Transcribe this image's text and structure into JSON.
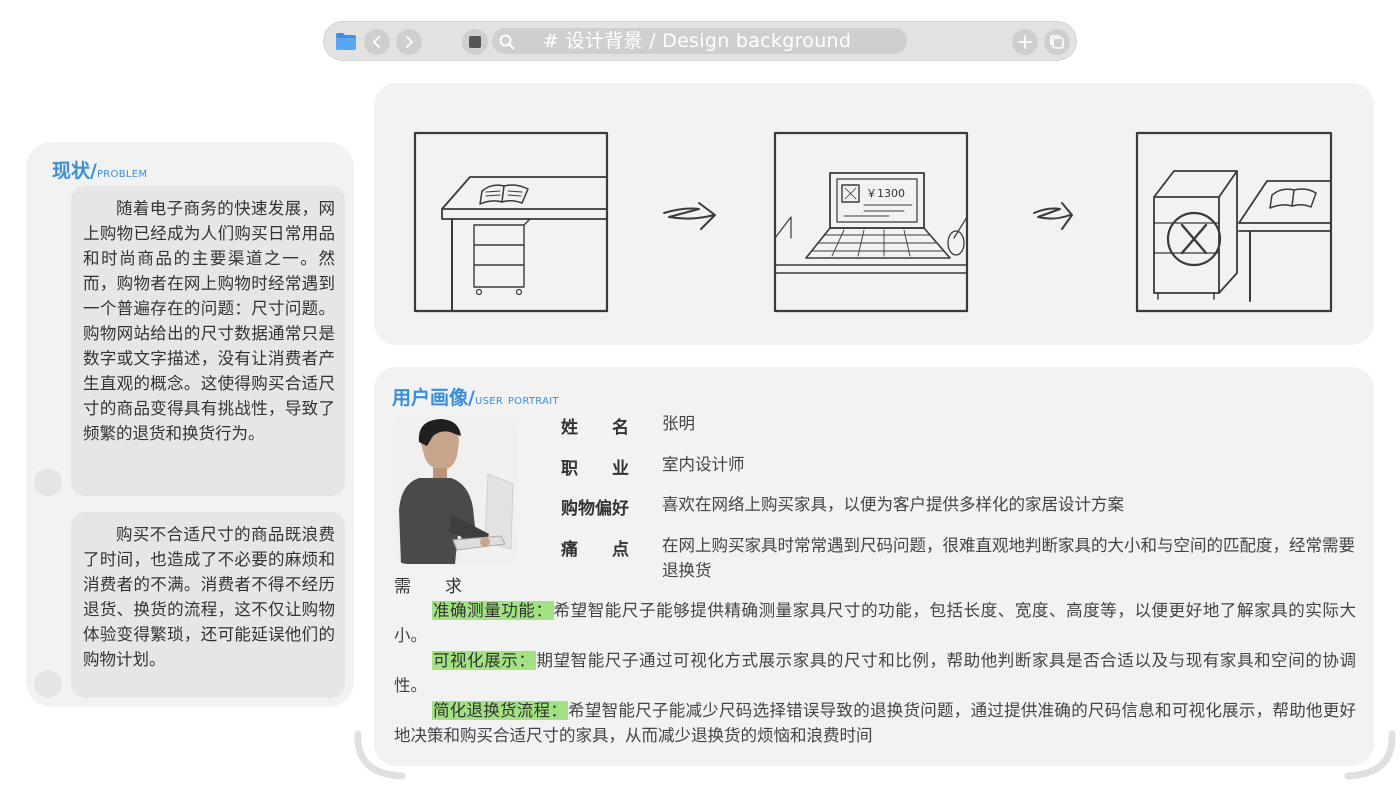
{
  "toolbar": {
    "address": "# 设计背景 / Design background"
  },
  "problem": {
    "title_zh": "现状/",
    "title_en": "problem",
    "paragraphs": [
      "随着电子商务的快速发展，网上购物已经成为人们购买日常用品和时尚商品的主要渠道之一。然而，购物者在网上购物时经常遇到一个普遍存在的问题：尺寸问题。购物网站给出的尺寸数据通常只是数字或文字描述，没有让消费者产生直观的概念。这使得购买合适尺寸的商品变得具有挑战性，导致了频繁的退货和换货行为。",
      "购买不合适尺寸的商品既浪费了时间，也造成了不必要的麻烦和消费者的不满。消费者不得不经历退货、换货的流程，这不仅让购物体验变得繁琐，还可能延误他们的购物计划。"
    ]
  },
  "storyboard": {
    "price_label": "￥1300"
  },
  "portrait": {
    "title_zh": "用户画像/",
    "title_en": "user portrait",
    "fields": [
      {
        "label": "姓　　名",
        "value": "张明"
      },
      {
        "label": "职　　业",
        "value": "室内设计师"
      },
      {
        "label": "购物偏好",
        "value": "喜欢在网络上购买家具，以便为客户提供多样化的家居设计方案"
      },
      {
        "label": "痛　　点",
        "value": "在网上购买家具时常常遇到尺码问题，很难直观地判断家具的大小和与空间的匹配度，经常需要退换货"
      }
    ],
    "needs_label": "需　　求",
    "needs": [
      {
        "title": "准确测量功能：",
        "text": "希望智能尺子能够提供精确测量家具尺寸的功能，包括长度、宽度、高度等，以便更好地了解家具的实际大小。"
      },
      {
        "title": "可视化展示：",
        "text": "期望智能尺子通过可视化方式展示家具的尺寸和比例，帮助他判断家具是否合适以及与现有家具和空间的协调性。"
      },
      {
        "title": "简化退换货流程：",
        "text": "希望智能尺子能减少尺码选择错误导致的退换货问题，通过提供准确的尺码信息和可视化展示，帮助他更好地决策和购买合适尺寸的家具，从而减少退换货的烦恼和浪费时间"
      }
    ]
  },
  "colors": {
    "accent": "#3a8fd9",
    "highlight": "#a3e283",
    "panel": "#f2f2f2",
    "bubble": "#e6e6e6"
  }
}
